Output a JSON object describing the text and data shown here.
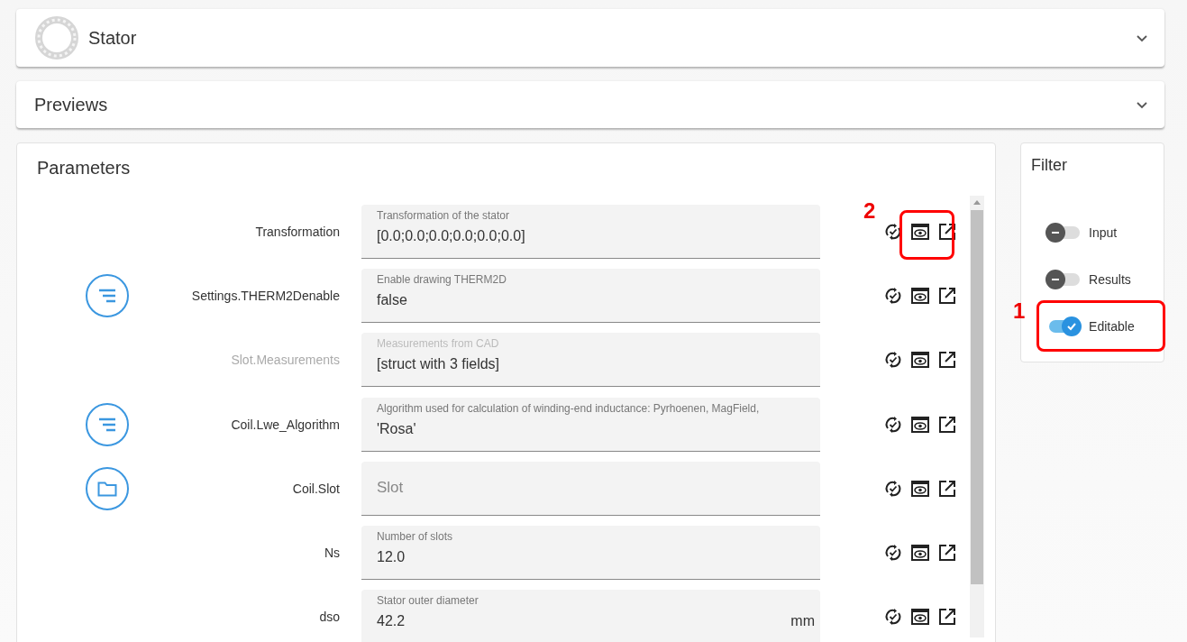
{
  "sections": [
    {
      "title": "Stator",
      "kind": "bearing",
      "expanded": false
    },
    {
      "title": "Previews",
      "kind": "plain",
      "expanded": false
    }
  ],
  "parameters": {
    "title": "Parameters",
    "rows": [
      {
        "label": "Transformation",
        "muted": false,
        "kind": "none",
        "hint": "Transformation of the stator",
        "hint_muted": false,
        "value": "[0.0;0.0;0.0;0.0;0.0;0.0]",
        "annotation": "2"
      },
      {
        "label": "Settings.THERM2Denable",
        "muted": false,
        "kind": "list",
        "hint": "Enable drawing THERM2D",
        "hint_muted": false,
        "value": "false"
      },
      {
        "label": "Slot.Measurements",
        "muted": true,
        "kind": "none",
        "hint": "Measurements from CAD",
        "hint_muted": true,
        "value": "[struct with 3 fields]"
      },
      {
        "label": "Coil.Lwe_Algorithm",
        "muted": false,
        "kind": "list",
        "hint": "Algorithm used for calculation of winding-end inductance: Pyrhoenen, MagField,",
        "hint_muted": false,
        "value": "'Rosa'"
      },
      {
        "label": "Coil.Slot",
        "muted": false,
        "kind": "folder",
        "placeholder": "Slot"
      },
      {
        "label": "Ns",
        "muted": false,
        "kind": "none",
        "hint": "Number of slots",
        "hint_muted": false,
        "value": "12.0"
      },
      {
        "label": "dso",
        "muted": false,
        "kind": "none",
        "hint": "Stator outer diameter",
        "hint_muted": false,
        "value": "42.2",
        "unit": "mm"
      }
    ]
  },
  "filter": {
    "title": "Filter",
    "toggles": [
      {
        "label": "Input",
        "on": false
      },
      {
        "label": "Results",
        "on": false
      },
      {
        "label": "Editable",
        "on": true,
        "annotation": "1"
      }
    ]
  }
}
